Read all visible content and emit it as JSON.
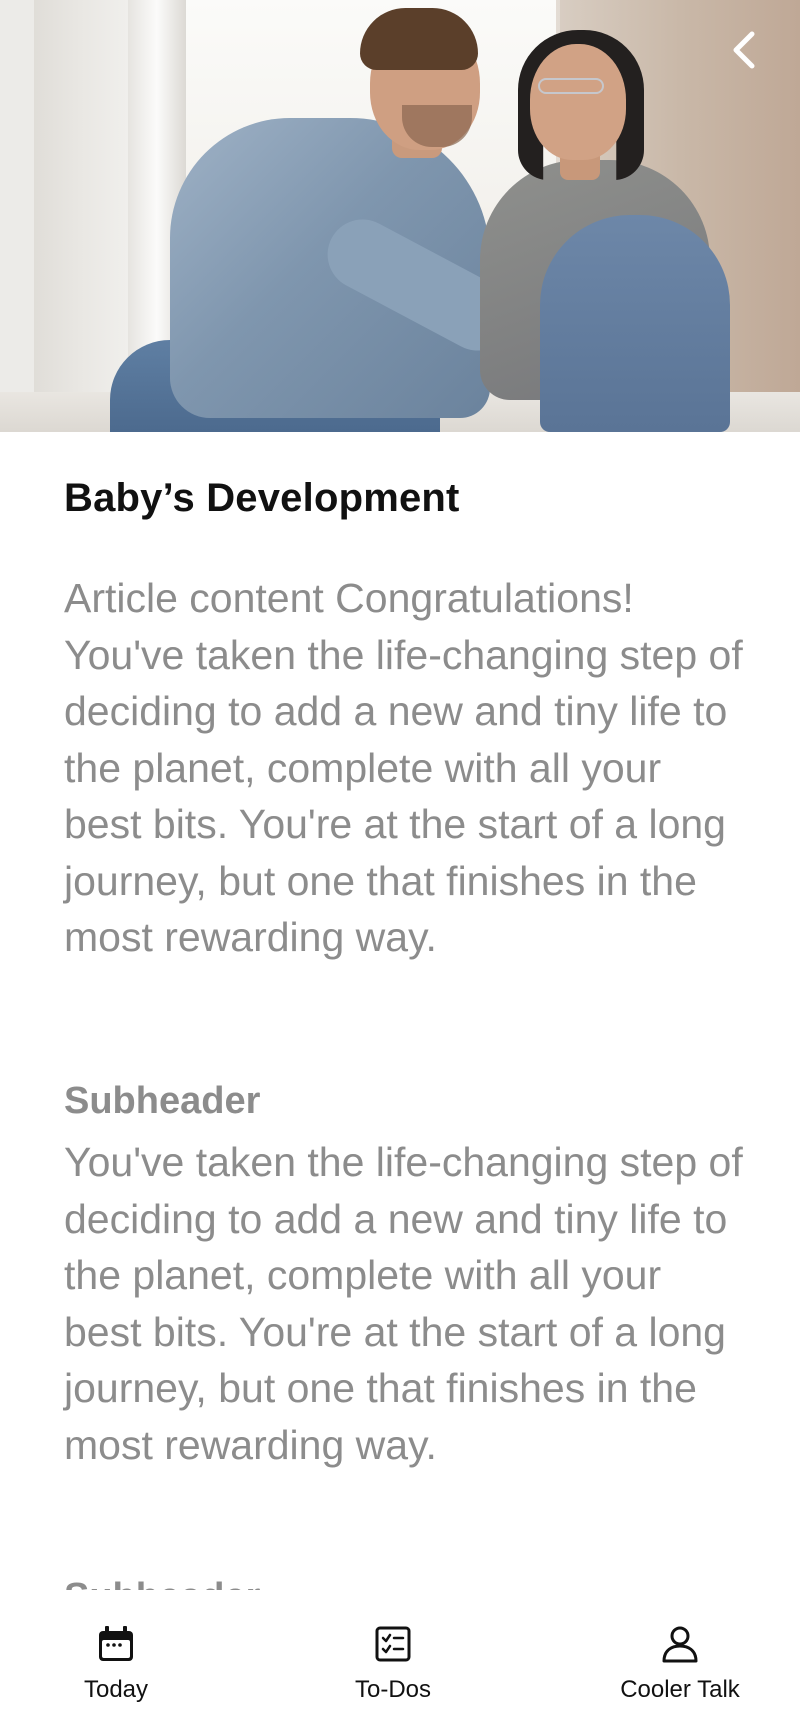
{
  "hero": {
    "image_description": "",
    "back_icon": "chevron-left-icon"
  },
  "article": {
    "title": "Baby’s Development",
    "paragraph_1": "Article content Congratulations! You've taken the life-changing step of deciding to add a new and tiny life to the planet, complete with all your best bits. You're at the start of a long journey, but one that finishes in the most rewarding way.",
    "subheader_1": "Subheader",
    "paragraph_2": "You've taken the life-changing step of deciding to add a new and tiny life to the planet, complete with all your best bits. You're at the start of a long journey, but one that finishes in the most rewarding way.",
    "subheader_2": "Subheader"
  },
  "bottom_nav": {
    "items": [
      {
        "label": "Today",
        "icon": "calendar-icon"
      },
      {
        "label": "To-Dos",
        "icon": "checklist-icon"
      },
      {
        "label": "Cooler Talk",
        "icon": "person-icon"
      }
    ]
  },
  "colors": {
    "title": "#111111",
    "body_text": "#8c8c8c",
    "background": "#ffffff",
    "nav_icon": "#111111"
  }
}
